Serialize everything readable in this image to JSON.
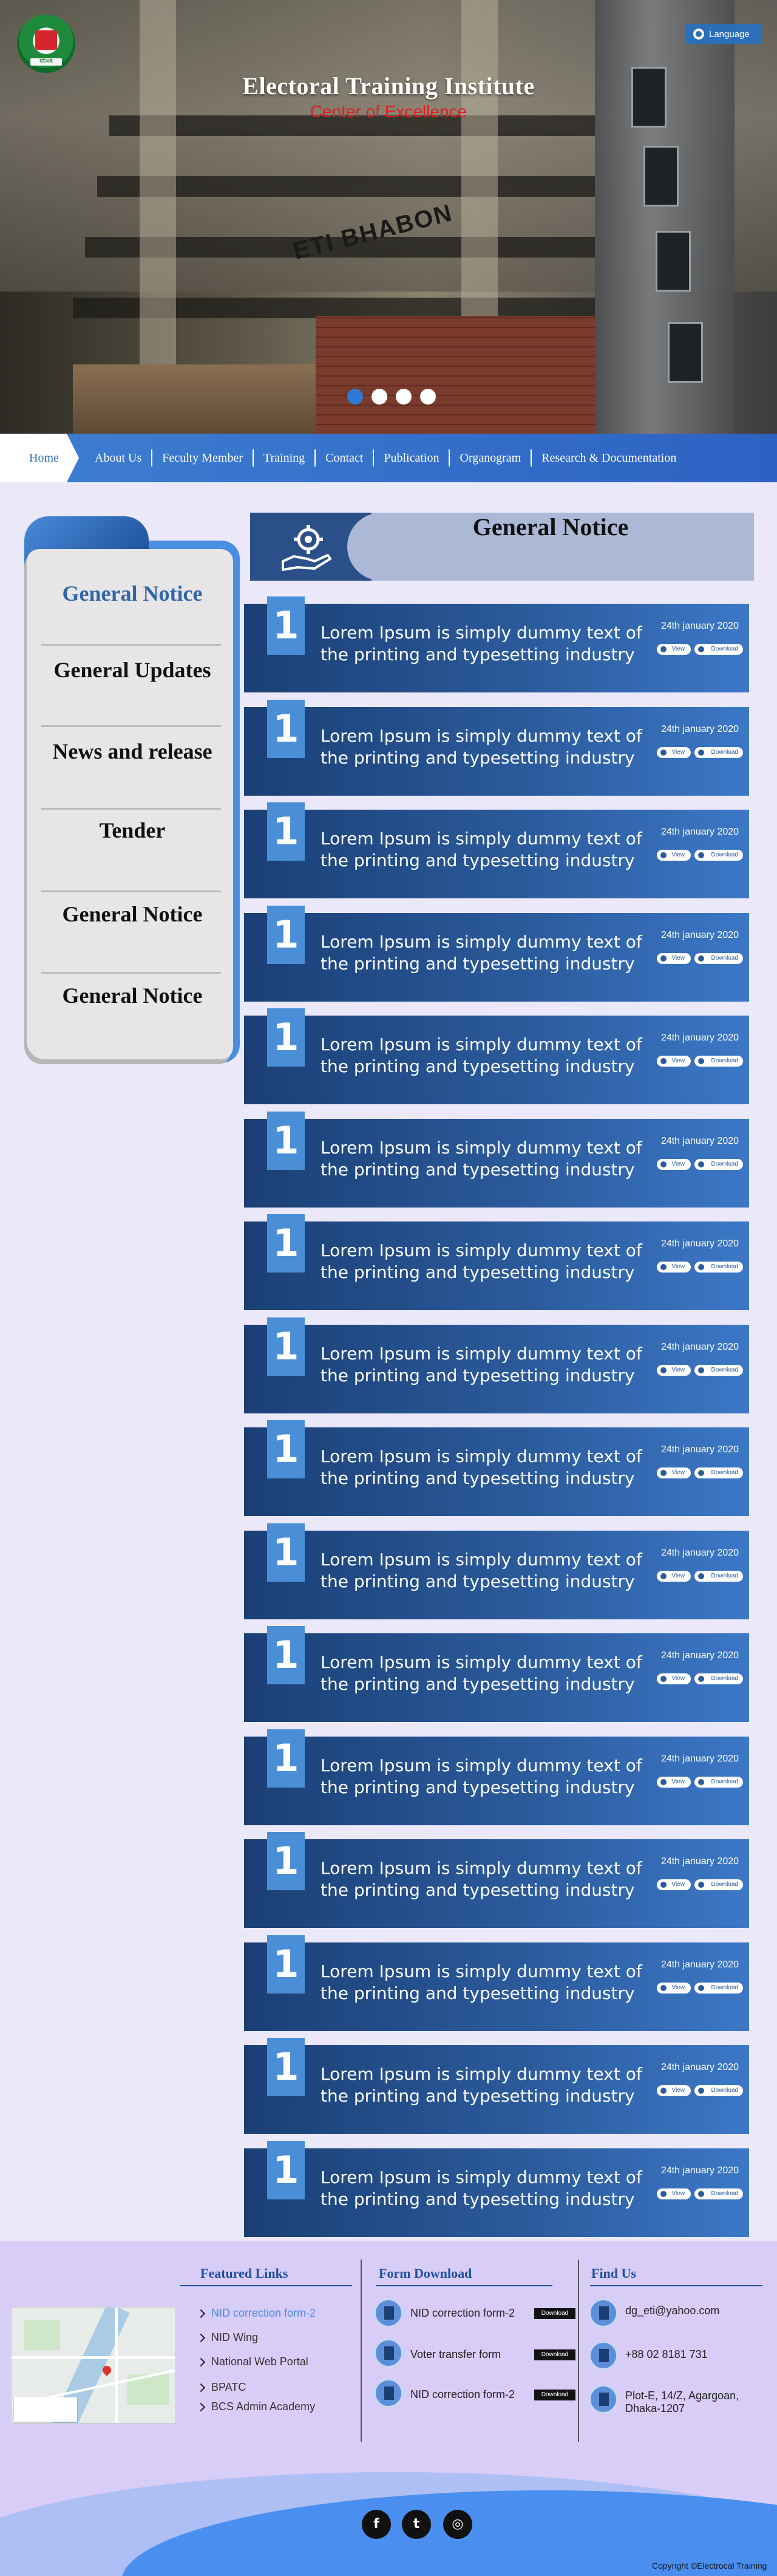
{
  "hero": {
    "title": "Electoral Training Institute",
    "subtitle": "Center of Excellence",
    "building_sign": "ETI BHABON",
    "language_button": "Language",
    "slider_dots": 4,
    "slider_active": 0,
    "logo_banner_text": "ইটিআই"
  },
  "nav": {
    "home": "Home",
    "items": [
      "About Us",
      "Feculty Member",
      "Training",
      "Contact",
      "Publication",
      "Organogram",
      "Research & Documentation"
    ]
  },
  "sidebar": {
    "items": [
      "General Notice",
      "General Updates",
      "News and release",
      "Tender",
      "General Notice",
      "General Notice"
    ],
    "active_index": 0
  },
  "section": {
    "title": "General Notice"
  },
  "notices": [
    {
      "num": "1",
      "text": "Lorem Ipsum is simply dummy text of the printing and typesetting industry",
      "date": "24th january 2020",
      "view": "View",
      "download": "Download"
    },
    {
      "num": "1",
      "text": "Lorem Ipsum is simply dummy text of the printing and typesetting industry",
      "date": "24th january 2020",
      "view": "View",
      "download": "Download"
    },
    {
      "num": "1",
      "text": "Lorem Ipsum is simply dummy text of the printing and typesetting industry",
      "date": "24th january 2020",
      "view": "View",
      "download": "Download"
    },
    {
      "num": "1",
      "text": "Lorem Ipsum is simply dummy text of the printing and typesetting industry",
      "date": "24th january 2020",
      "view": "View",
      "download": "Download"
    },
    {
      "num": "1",
      "text": "Lorem Ipsum is simply dummy text of the printing and typesetting industry",
      "date": "24th january 2020",
      "view": "View",
      "download": "Download"
    },
    {
      "num": "1",
      "text": "Lorem Ipsum is simply dummy text of the printing and typesetting industry",
      "date": "24th january 2020",
      "view": "View",
      "download": "Download"
    },
    {
      "num": "1",
      "text": "Lorem Ipsum is simply dummy text of the printing and typesetting industry",
      "date": "24th january 2020",
      "view": "View",
      "download": "Download"
    },
    {
      "num": "1",
      "text": "Lorem Ipsum is simply dummy text of the printing and typesetting industry",
      "date": "24th january 2020",
      "view": "View",
      "download": "Download"
    },
    {
      "num": "1",
      "text": "Lorem Ipsum is simply dummy text of the printing and typesetting industry",
      "date": "24th january 2020",
      "view": "View",
      "download": "Download"
    },
    {
      "num": "1",
      "text": "Lorem Ipsum is simply dummy text of the printing and typesetting industry",
      "date": "24th january 2020",
      "view": "View",
      "download": "Download"
    },
    {
      "num": "1",
      "text": "Lorem Ipsum is simply dummy text of the printing and typesetting industry",
      "date": "24th january 2020",
      "view": "View",
      "download": "Download"
    },
    {
      "num": "1",
      "text": "Lorem Ipsum is simply dummy text of the printing and typesetting industry",
      "date": "24th january 2020",
      "view": "View",
      "download": "Download"
    },
    {
      "num": "1",
      "text": "Lorem Ipsum is simply dummy text of the printing and typesetting industry",
      "date": "24th january 2020",
      "view": "View",
      "download": "Download"
    },
    {
      "num": "1",
      "text": "Lorem Ipsum is simply dummy text of the printing and typesetting industry",
      "date": "24th january 2020",
      "view": "View",
      "download": "Download"
    },
    {
      "num": "1",
      "text": "Lorem Ipsum is simply dummy text of the printing and typesetting industry",
      "date": "24th january 2020",
      "view": "View",
      "download": "Download"
    },
    {
      "num": "1",
      "text": "Lorem Ipsum is simply dummy text of the printing and typesetting industry",
      "date": "24th january 2020",
      "view": "View",
      "download": "Download"
    }
  ],
  "footer": {
    "featured_links": {
      "title": "Featured Links",
      "items": [
        "NID correction form-2",
        "NID Wing",
        "National Web Portal",
        "BPATC",
        "BCS Admin Academy"
      ],
      "active_index": 0
    },
    "form_download": {
      "title": "Form Download",
      "items": [
        "NID correction form-2",
        "Voter transfer form",
        "NID correction form-2"
      ],
      "download_label": "Download"
    },
    "find_us": {
      "title": "Find Us",
      "email": "dg_eti@yahoo.com",
      "phone": "+88 02 8181 731",
      "address": "Plot-E, 14/Z, Agargoan, Dhaka-1207"
    },
    "social": [
      "facebook-icon",
      "twitter-icon",
      "globe-icon"
    ],
    "copyright": "Copyright ©Electrocal Training"
  },
  "colors": {
    "brand_blue": "#2e71c9",
    "notice_dark": "#1b3f75",
    "notice_light": "#3c78c7",
    "accent_red": "#e51d1d",
    "footer_bg": "#d8cdf7"
  }
}
